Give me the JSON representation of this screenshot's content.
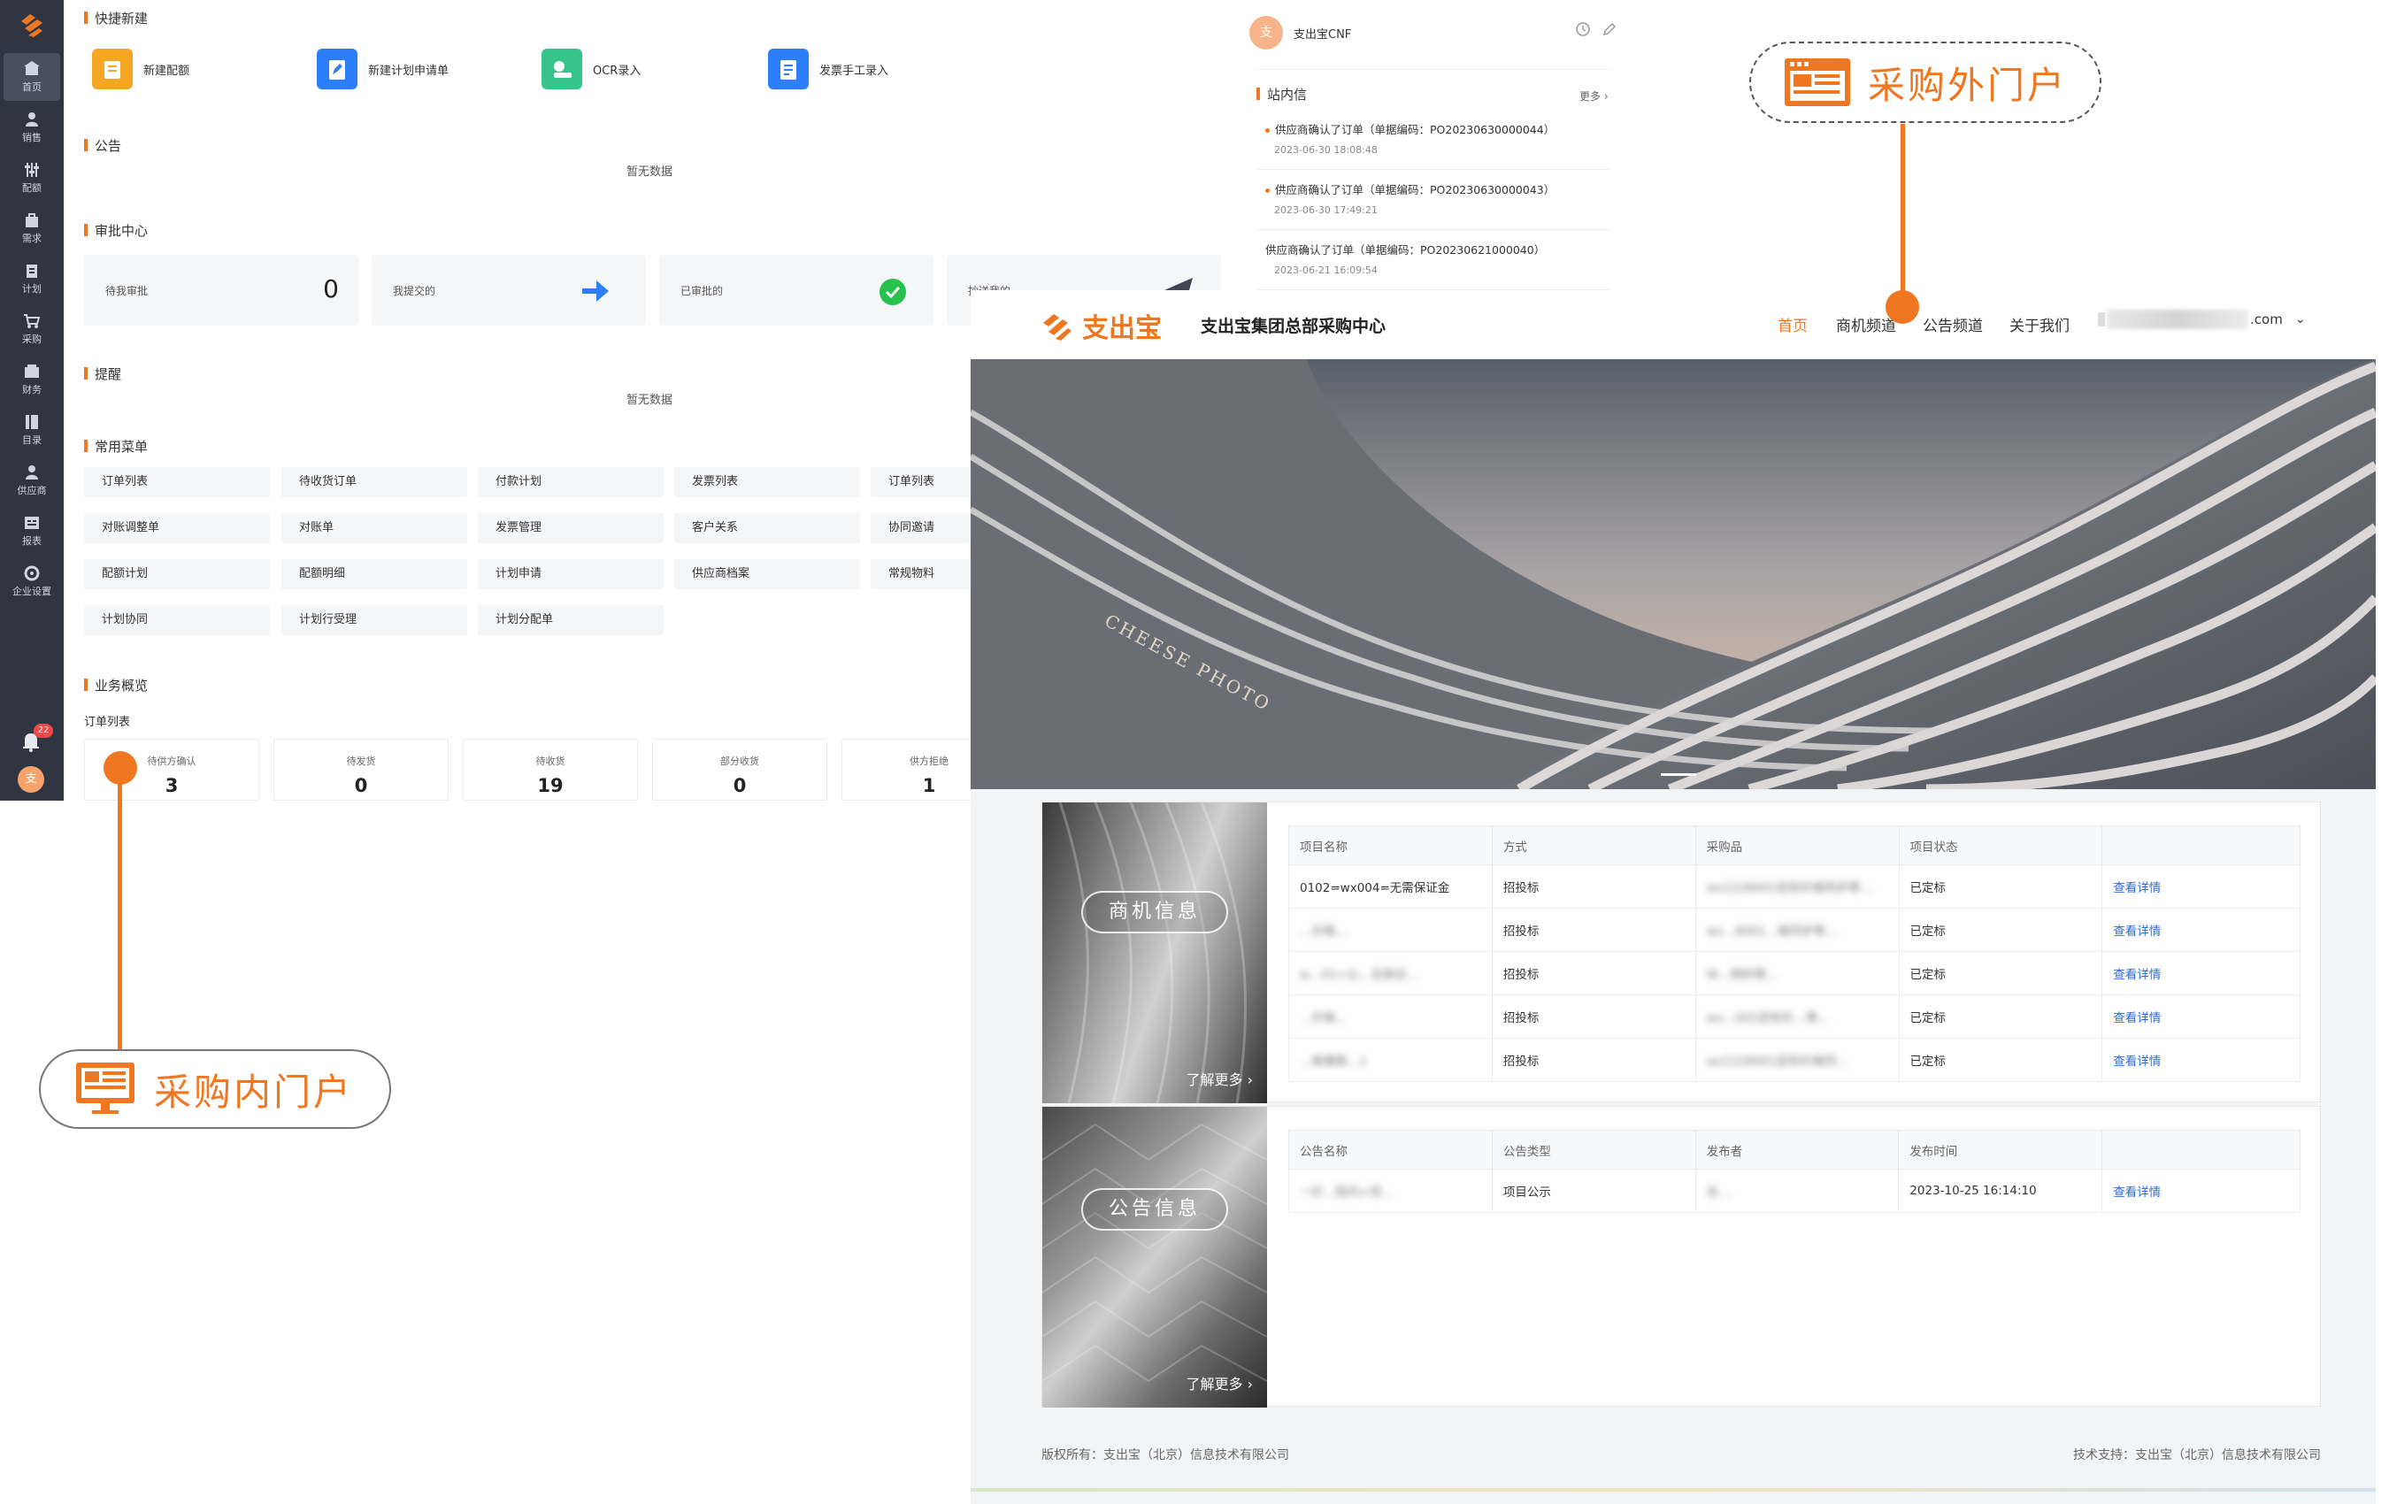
{
  "inner_portal": {
    "sidebar": [
      {
        "label": "首页",
        "icon": "home-icon",
        "active": true
      },
      {
        "label": "销售",
        "icon": "user-icon"
      },
      {
        "label": "配额",
        "icon": "sliders-icon"
      },
      {
        "label": "需求",
        "icon": "bag-icon"
      },
      {
        "label": "计划",
        "icon": "clipboard-icon"
      },
      {
        "label": "采购",
        "icon": "cart-icon"
      },
      {
        "label": "财务",
        "icon": "wallet-icon"
      },
      {
        "label": "目录",
        "icon": "catalog-icon"
      },
      {
        "label": "供应商",
        "icon": "supplier-icon"
      },
      {
        "label": "报表",
        "icon": "report-icon"
      },
      {
        "label": "企业设置",
        "icon": "gear-icon"
      }
    ],
    "notification_badge": "22",
    "avatar_initial": "支",
    "quick_create": {
      "title": "快捷新建",
      "items": [
        {
          "label": "新建配额",
          "icon": "quota-icon",
          "color": "#f5a623"
        },
        {
          "label": "新建计划申请单",
          "icon": "edit-doc-icon",
          "color": "#2d7ff9"
        },
        {
          "label": "OCR录入",
          "icon": "ocr-icon",
          "color": "#36c48a"
        },
        {
          "label": "发票手工录入",
          "icon": "invoice-icon",
          "color": "#2d7ff9"
        }
      ]
    },
    "announcement": {
      "title": "公告",
      "empty": "暂无数据"
    },
    "approval": {
      "title": "审批中心",
      "cards": [
        {
          "label": "待我审批",
          "value": "0"
        },
        {
          "label": "我提交的",
          "icon": "forward-arrow-icon"
        },
        {
          "label": "已审批的",
          "icon": "check-circle-icon"
        },
        {
          "label": "抄送我的",
          "icon": "send-plane-icon"
        }
      ]
    },
    "reminder": {
      "title": "提醒",
      "empty": "暂无数据"
    },
    "common_menu": {
      "title": "常用菜单",
      "rows": [
        [
          "订单列表",
          "待收货订单",
          "付款计划",
          "发票列表",
          "订单列表"
        ],
        [
          "对账调整单",
          "对账单",
          "发票管理",
          "客户关系",
          "协同邀请"
        ],
        [
          "配额计划",
          "配额明细",
          "计划申请",
          "供应商档案",
          "常规物料"
        ],
        [
          "计划协同",
          "计划行受理",
          "计划分配单"
        ]
      ]
    },
    "business": {
      "title": "业务概览",
      "subtitle": "订单列表",
      "stats": [
        {
          "label": "待供方确认",
          "value": "3"
        },
        {
          "label": "待发货",
          "value": "0"
        },
        {
          "label": "待收货",
          "value": "19"
        },
        {
          "label": "部分收货",
          "value": "0"
        },
        {
          "label": "供方拒绝",
          "value": "1"
        }
      ]
    }
  },
  "messages_panel": {
    "user_name": "支出宝CNF",
    "avatar_initial": "支",
    "title": "站内信",
    "more": "更多",
    "items": [
      {
        "text": "供应商确认了订单（单据编码：PO20230630000044）",
        "time": "2023-06-30 18:08:48",
        "unread": true
      },
      {
        "text": "供应商确认了订单（单据编码：PO20230630000043）",
        "time": "2023-06-30 17:49:21",
        "unread": true
      },
      {
        "text": "供应商确认了订单（单据编码：PO20230621000040）",
        "time": "2023-06-21 16:09:54",
        "unread": false
      }
    ]
  },
  "outer_portal": {
    "brand": "支出宝",
    "site_title": "支出宝集团总部采购中心",
    "nav": [
      "首页",
      "商机频道",
      "公告频道",
      "关于我们"
    ],
    "account_suffix": ".com",
    "hero_sign_text": "CHEESE PHOTO",
    "opportunity": {
      "pill": "商机信息",
      "more": "了解更多",
      "headers": [
        "项目名称",
        "方式",
        "采购品",
        "项目状态",
        ""
      ],
      "rows": [
        [
          "0102=wx004=无需保证金",
          "招投标",
          "wx1228001定标价格同步等…",
          "已定标",
          "查看详情"
        ],
        [
          "…价格…",
          "招投标",
          "wx…8001…格同步等…",
          "已定标",
          "查看详情"
        ],
        [
          "w…01+公…无保证…",
          "招投标",
          "W…物料等…",
          "已定标",
          "查看详情"
        ],
        [
          "…价格…",
          "招投标",
          "wx…001定标价…等…",
          "已定标",
          "查看详情"
        ],
        [
          "…格事数…1",
          "招投标",
          "wx1228001定标价格同…",
          "已定标",
          "查看详情"
        ]
      ]
    },
    "announcement": {
      "pill": "公告信息",
      "more": "了解更多",
      "headers": [
        "公告名称",
        "公告类型",
        "发布者",
        "发布时间",
        ""
      ],
      "rows": [
        [
          "一於…院内+项…",
          "项目公示",
          "支…",
          "2023-10-25 16:14:10",
          "查看详情"
        ]
      ]
    },
    "footer_left": "版权所有：支出宝（北京）信息技术有限公司",
    "footer_right": "技术支持：支出宝（北京）信息技术有限公司"
  },
  "callouts": {
    "outer": "采购外门户",
    "inner": "采购内门户"
  },
  "accent_color": "#f07722"
}
